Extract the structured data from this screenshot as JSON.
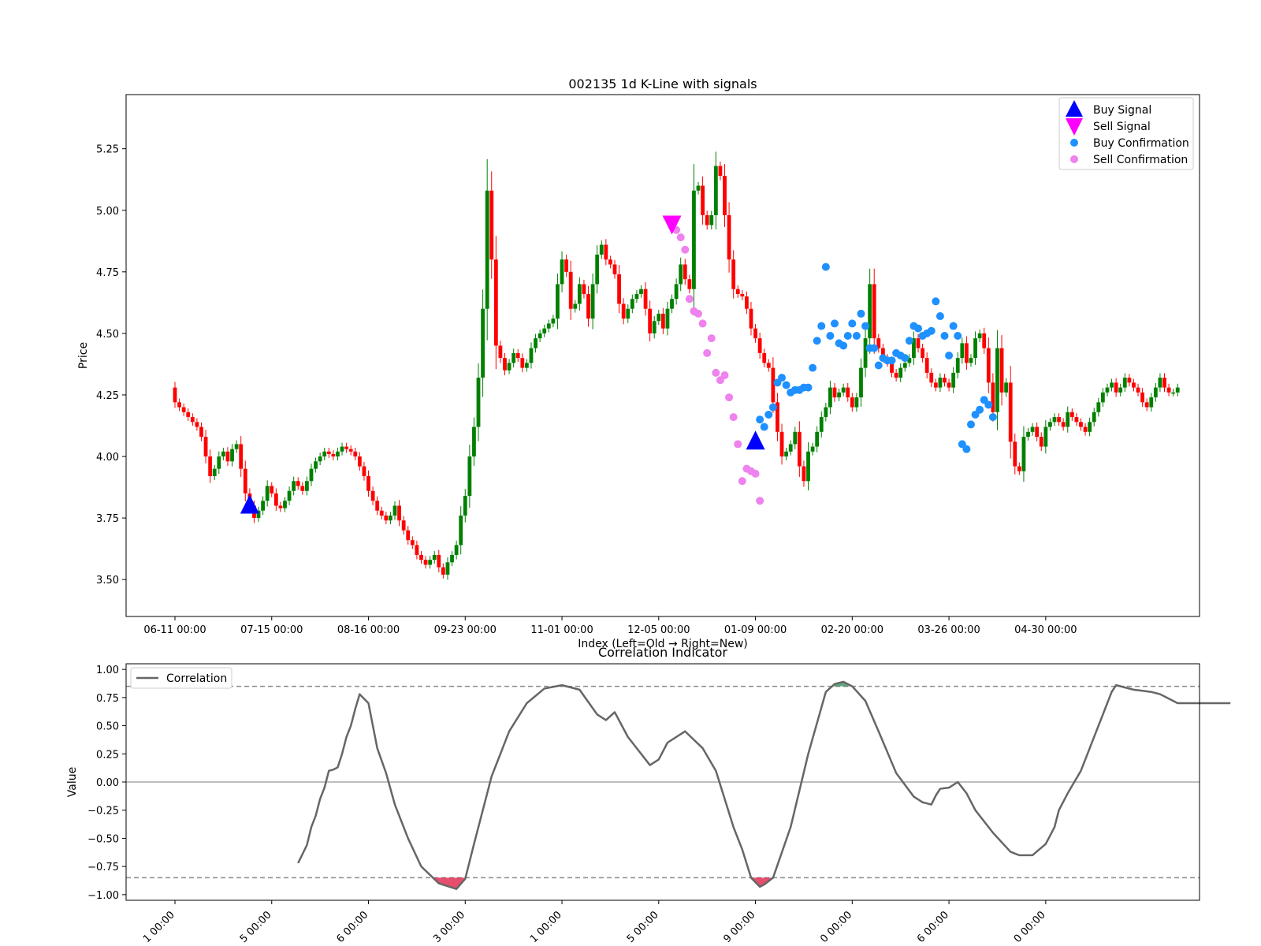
{
  "chart_data": [
    {
      "type": "candlestick",
      "title": "002135 1d K-Line with signals",
      "xlabel": "Index (Left=Old → Right=New)",
      "ylabel": "Price",
      "ylim": [
        3.35,
        5.47
      ],
      "yticks": [
        "3.50",
        "3.75",
        "4.00",
        "4.25",
        "4.50",
        "4.75",
        "5.00",
        "5.25"
      ],
      "xticks": [
        {
          "i": 0,
          "label": "06-11 00:00"
        },
        {
          "i": 22,
          "label": "07-15 00:00"
        },
        {
          "i": 44,
          "label": "08-16 00:00"
        },
        {
          "i": 66,
          "label": "09-23 00:00"
        },
        {
          "i": 88,
          "label": "11-01 00:00"
        },
        {
          "i": 110,
          "label": "12-05 00:00"
        },
        {
          "i": 132,
          "label": "01-09 00:00"
        },
        {
          "i": 154,
          "label": "02-20 00:00"
        },
        {
          "i": 176,
          "label": "03-26 00:00"
        },
        {
          "i": 198,
          "label": "04-30 00:00"
        }
      ],
      "close": [
        4.22,
        4.2,
        4.18,
        4.16,
        4.14,
        4.12,
        4.08,
        4.0,
        3.92,
        3.95,
        4.0,
        4.02,
        3.98,
        4.03,
        4.05,
        3.95,
        3.85,
        3.8,
        3.75,
        3.78,
        3.82,
        3.88,
        3.85,
        3.8,
        3.79,
        3.82,
        3.86,
        3.9,
        3.88,
        3.86,
        3.9,
        3.95,
        3.98,
        4.0,
        4.02,
        4.01,
        4.0,
        4.02,
        4.04,
        4.03,
        4.02,
        4.0,
        3.96,
        3.92,
        3.86,
        3.82,
        3.78,
        3.76,
        3.74,
        3.76,
        3.8,
        3.74,
        3.7,
        3.66,
        3.64,
        3.6,
        3.58,
        3.56,
        3.58,
        3.6,
        3.55,
        3.52,
        3.57,
        3.6,
        3.64,
        3.76,
        3.84,
        4.0,
        4.12,
        4.32,
        4.6,
        5.08,
        4.8,
        4.45,
        4.4,
        4.35,
        4.38,
        4.42,
        4.4,
        4.36,
        4.38,
        4.44,
        4.48,
        4.5,
        4.52,
        4.54,
        4.56,
        4.7,
        4.8,
        4.75,
        4.6,
        4.62,
        4.7,
        4.66,
        4.56,
        4.7,
        4.82,
        4.86,
        4.8,
        4.78,
        4.74,
        4.62,
        4.56,
        4.6,
        4.64,
        4.66,
        4.68,
        4.6,
        4.5,
        4.55,
        4.58,
        4.52,
        4.6,
        4.64,
        4.7,
        4.78,
        4.72,
        4.68,
        5.08,
        5.1,
        4.98,
        4.94,
        4.98,
        5.18,
        5.14,
        4.98,
        4.8,
        4.68,
        4.66,
        4.65,
        4.6,
        4.52,
        4.48,
        4.42,
        4.38,
        4.36,
        4.22,
        4.1,
        4.0,
        4.02,
        4.05,
        4.1,
        3.96,
        3.9,
        4.02,
        4.04,
        4.1,
        4.16,
        4.2,
        4.28,
        4.24,
        4.26,
        4.28,
        4.24,
        4.2,
        4.24,
        4.36,
        4.48,
        4.7,
        4.48,
        4.44,
        4.4,
        4.38,
        4.34,
        4.32,
        4.36,
        4.38,
        4.4,
        4.48,
        4.44,
        4.4,
        4.34,
        4.3,
        4.28,
        4.32,
        4.3,
        4.28,
        4.34,
        4.4,
        4.46,
        4.38,
        4.4,
        4.48,
        4.5,
        4.44,
        4.3,
        4.18,
        4.44,
        4.26,
        4.3,
        4.06,
        3.96,
        3.94,
        4.08,
        4.1,
        4.12,
        4.08,
        4.04,
        4.12,
        4.14,
        4.16,
        4.14,
        4.12,
        4.18,
        4.16,
        4.14,
        4.12,
        4.1,
        4.14,
        4.18,
        4.22,
        4.26,
        4.28,
        4.3,
        4.26,
        4.28,
        4.32,
        4.3,
        4.28,
        4.26,
        4.22,
        4.2,
        4.24,
        4.28,
        4.32,
        4.28,
        4.26,
        4.26,
        4.28
      ],
      "signals": {
        "Buy Signal": [
          {
            "i": 17,
            "price": 3.8
          },
          {
            "i": 132,
            "price": 4.06
          }
        ],
        "Sell Signal": [
          {
            "i": 113,
            "price": 4.94
          }
        ],
        "Buy Confirmation": [
          {
            "i": 133,
            "price": 4.15
          },
          {
            "i": 134,
            "price": 4.12
          },
          {
            "i": 135,
            "price": 4.17
          },
          {
            "i": 136,
            "price": 4.2
          },
          {
            "i": 137,
            "price": 4.3
          },
          {
            "i": 138,
            "price": 4.32
          },
          {
            "i": 139,
            "price": 4.29
          },
          {
            "i": 140,
            "price": 4.26
          },
          {
            "i": 141,
            "price": 4.27
          },
          {
            "i": 142,
            "price": 4.27
          },
          {
            "i": 143,
            "price": 4.28
          },
          {
            "i": 144,
            "price": 4.28
          },
          {
            "i": 145,
            "price": 4.36
          },
          {
            "i": 146,
            "price": 4.47
          },
          {
            "i": 147,
            "price": 4.53
          },
          {
            "i": 148,
            "price": 4.77
          },
          {
            "i": 149,
            "price": 4.49
          },
          {
            "i": 150,
            "price": 4.54
          },
          {
            "i": 151,
            "price": 4.46
          },
          {
            "i": 152,
            "price": 4.45
          },
          {
            "i": 153,
            "price": 4.49
          },
          {
            "i": 154,
            "price": 4.54
          },
          {
            "i": 155,
            "price": 4.49
          },
          {
            "i": 156,
            "price": 4.58
          },
          {
            "i": 157,
            "price": 4.53
          },
          {
            "i": 158,
            "price": 4.44
          },
          {
            "i": 159,
            "price": 4.44
          },
          {
            "i": 160,
            "price": 4.37
          },
          {
            "i": 161,
            "price": 4.4
          },
          {
            "i": 162,
            "price": 4.39
          },
          {
            "i": 163,
            "price": 4.39
          },
          {
            "i": 164,
            "price": 4.42
          },
          {
            "i": 165,
            "price": 4.41
          },
          {
            "i": 166,
            "price": 4.4
          },
          {
            "i": 167,
            "price": 4.47
          },
          {
            "i": 168,
            "price": 4.53
          },
          {
            "i": 169,
            "price": 4.52
          },
          {
            "i": 170,
            "price": 4.49
          },
          {
            "i": 171,
            "price": 4.5
          },
          {
            "i": 172,
            "price": 4.51
          },
          {
            "i": 173,
            "price": 4.63
          },
          {
            "i": 174,
            "price": 4.57
          },
          {
            "i": 175,
            "price": 4.49
          },
          {
            "i": 176,
            "price": 4.41
          },
          {
            "i": 177,
            "price": 4.53
          },
          {
            "i": 178,
            "price": 4.49
          },
          {
            "i": 179,
            "price": 4.05
          },
          {
            "i": 180,
            "price": 4.03
          },
          {
            "i": 181,
            "price": 4.13
          },
          {
            "i": 182,
            "price": 4.17
          },
          {
            "i": 183,
            "price": 4.19
          },
          {
            "i": 184,
            "price": 4.23
          },
          {
            "i": 185,
            "price": 4.21
          },
          {
            "i": 186,
            "price": 4.16
          }
        ],
        "Sell Confirmation": [
          {
            "i": 114,
            "price": 4.92
          },
          {
            "i": 115,
            "price": 4.89
          },
          {
            "i": 116,
            "price": 4.84
          },
          {
            "i": 117,
            "price": 4.64
          },
          {
            "i": 118,
            "price": 4.59
          },
          {
            "i": 119,
            "price": 4.58
          },
          {
            "i": 120,
            "price": 4.54
          },
          {
            "i": 121,
            "price": 4.42
          },
          {
            "i": 122,
            "price": 4.48
          },
          {
            "i": 123,
            "price": 4.34
          },
          {
            "i": 124,
            "price": 4.31
          },
          {
            "i": 125,
            "price": 4.33
          },
          {
            "i": 126,
            "price": 4.24
          },
          {
            "i": 127,
            "price": 4.16
          },
          {
            "i": 128,
            "price": 4.05
          },
          {
            "i": 129,
            "price": 3.9
          },
          {
            "i": 130,
            "price": 3.95
          },
          {
            "i": 131,
            "price": 3.94
          },
          {
            "i": 132,
            "price": 3.93
          },
          {
            "i": 133,
            "price": 3.82
          }
        ]
      },
      "colors": {
        "up": "#008000",
        "down": "#ff0000",
        "buy_signal": "#0000ff",
        "sell_signal": "#ff00ff",
        "buy_confirmation": "#1e90ff",
        "sell_confirmation": "#ee82ee"
      },
      "legend": {
        "position": "top-right",
        "entries": [
          "Buy Signal",
          "Sell Signal",
          "Buy Confirmation",
          "Sell Confirmation"
        ]
      }
    },
    {
      "type": "line",
      "title": "Correlation Indicator",
      "xlabel": "",
      "ylabel": "Value",
      "ylim": [
        -1.05,
        1.05
      ],
      "yticks": [
        "−1.00",
        "−0.75",
        "−0.50",
        "−0.25",
        "0.00",
        "0.25",
        "0.50",
        "0.75",
        "1.00"
      ],
      "xticklabels": [
        "1 00:00",
        "5 00:00",
        "6 00:00",
        "3 00:00",
        "1 00:00",
        "5 00:00",
        "9 00:00",
        "0 00:00",
        "6 00:00",
        "0 00:00"
      ],
      "thresholds": [
        0.85,
        -0.85
      ],
      "zero_line": 0,
      "series": [
        {
          "name": "Correlation",
          "color": "#666666",
          "x": [
            28,
            30,
            31,
            32,
            33,
            34,
            35,
            36,
            37,
            38,
            39,
            40,
            41,
            42,
            44,
            46,
            48,
            50,
            53,
            56,
            60,
            64,
            66,
            68,
            72,
            76,
            80,
            84,
            88,
            92,
            96,
            98,
            100,
            103,
            106,
            108,
            110,
            112,
            116,
            120,
            123,
            125,
            127,
            129,
            131,
            133,
            134,
            136,
            140,
            144,
            148,
            150,
            152,
            154,
            157,
            160,
            164,
            168,
            170,
            172,
            173,
            174,
            176,
            178,
            180,
            182,
            184,
            186,
            190,
            192,
            195,
            198,
            200,
            201,
            203,
            206,
            208,
            210,
            212,
            213,
            214,
            216,
            218,
            220,
            222,
            224,
            226,
            228,
            230,
            232,
            234,
            236,
            238,
            240
          ],
          "y": [
            -0.72,
            -0.56,
            -0.4,
            -0.3,
            -0.15,
            -0.05,
            0.1,
            0.11,
            0.13,
            0.25,
            0.4,
            0.5,
            0.65,
            0.78,
            0.7,
            0.3,
            0.08,
            -0.2,
            -0.5,
            -0.75,
            -0.9,
            -0.95,
            -0.86,
            -0.55,
            0.05,
            0.45,
            0.7,
            0.83,
            0.86,
            0.82,
            0.6,
            0.55,
            0.62,
            0.4,
            0.25,
            0.15,
            0.2,
            0.35,
            0.45,
            0.3,
            0.1,
            -0.15,
            -0.4,
            -0.6,
            -0.85,
            -0.93,
            -0.91,
            -0.85,
            -0.4,
            0.25,
            0.8,
            0.87,
            0.89,
            0.85,
            0.72,
            0.45,
            0.08,
            -0.13,
            -0.18,
            -0.2,
            -0.12,
            -0.06,
            -0.05,
            0.0,
            -0.1,
            -0.25,
            -0.35,
            -0.45,
            -0.62,
            -0.65,
            -0.65,
            -0.55,
            -0.4,
            -0.25,
            -0.1,
            0.1,
            0.3,
            0.5,
            0.7,
            0.8,
            0.86,
            0.84,
            0.82,
            0.81,
            0.8,
            0.78,
            0.74,
            0.7,
            0.7,
            0.7,
            0.7,
            0.7,
            0.7,
            0.7
          ]
        }
      ],
      "shading": {
        "above": "#2e8b57",
        "below": "#dc143c"
      },
      "legend": {
        "position": "top-left",
        "entries": [
          "Correlation"
        ]
      }
    }
  ]
}
